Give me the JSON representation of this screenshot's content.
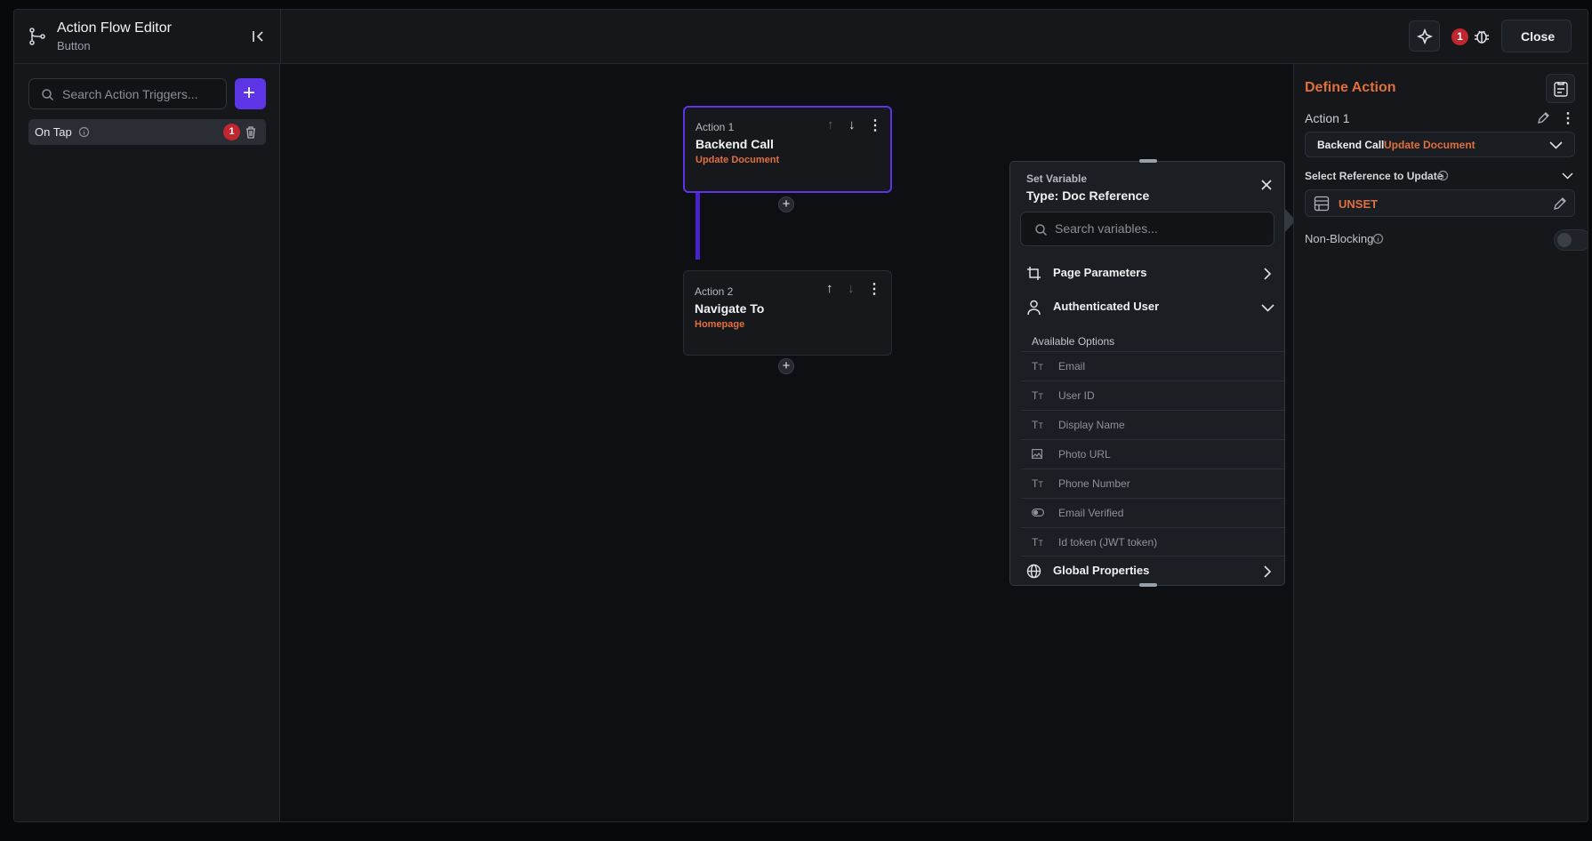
{
  "header": {
    "title": "Action Flow Editor",
    "subtitle": "Button",
    "error_count": "1",
    "close_label": "Close"
  },
  "left_panel": {
    "search_placeholder": "Search Action Triggers...",
    "triggers": [
      {
        "label": "On Tap",
        "badge": "1"
      }
    ]
  },
  "canvas": {
    "actions": [
      {
        "label": "Action 1",
        "title": "Backend Call",
        "subtitle": "Update Document"
      },
      {
        "label": "Action 2",
        "title": "Navigate To",
        "subtitle": "Homepage"
      }
    ]
  },
  "popup": {
    "heading": "Set Variable",
    "type_label": "Type: Doc Reference",
    "search_placeholder": "Search variables...",
    "sections": {
      "page_parameters": "Page Parameters",
      "authenticated_user": "Authenticated User",
      "available_options": "Available Options",
      "global_properties": "Global Properties"
    },
    "options": [
      {
        "label": "Email",
        "icon": "text-type-icon"
      },
      {
        "label": "User ID",
        "icon": "text-type-icon"
      },
      {
        "label": "Display Name",
        "icon": "text-type-icon"
      },
      {
        "label": "Photo URL",
        "icon": "image-icon"
      },
      {
        "label": "Phone Number",
        "icon": "text-type-icon"
      },
      {
        "label": "Email Verified",
        "icon": "toggle-icon"
      },
      {
        "label": "Id token (JWT token)",
        "icon": "text-type-icon"
      }
    ]
  },
  "right_panel": {
    "title": "Define Action",
    "action_name": "Action 1",
    "action_type": "Backend Call",
    "action_subtype": "Update Document",
    "reference_label": "Select Reference to Update",
    "reference_value": "UNSET",
    "non_blocking_label": "Non-Blocking"
  },
  "colors": {
    "accent": "#5b35e6",
    "highlight_text": "#e0703e",
    "error_badge": "#c0262d"
  }
}
